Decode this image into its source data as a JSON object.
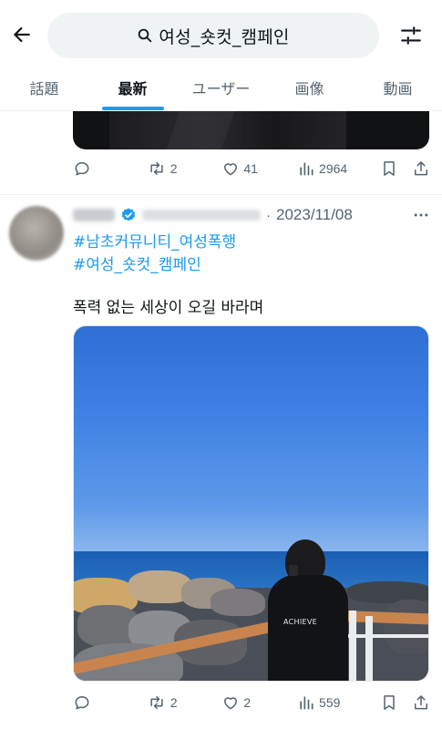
{
  "search": {
    "query": "여성_숏컷_캠페인"
  },
  "tabs": [
    {
      "label": "話題",
      "active": false
    },
    {
      "label": "最新",
      "active": true
    },
    {
      "label": "ユーザー",
      "active": false
    },
    {
      "label": "画像",
      "active": false
    },
    {
      "label": "動画",
      "active": false
    }
  ],
  "previous_tweet": {
    "retweets": "2",
    "likes": "41",
    "views": "2964"
  },
  "tweet": {
    "date": "2023/11/08",
    "dot": "·",
    "hashtags": [
      "#남초커뮤니티_여성폭행",
      "#여성_숏컷_캠페인"
    ],
    "text": "폭력 없는 세상이 오길 바라며",
    "image_jacket_text": "ACHIEVE",
    "retweets": "2",
    "likes": "2",
    "views": "559"
  },
  "colors": {
    "accent": "#1d9bf0",
    "secondary_text": "#536471",
    "primary_text": "#0f1419"
  }
}
